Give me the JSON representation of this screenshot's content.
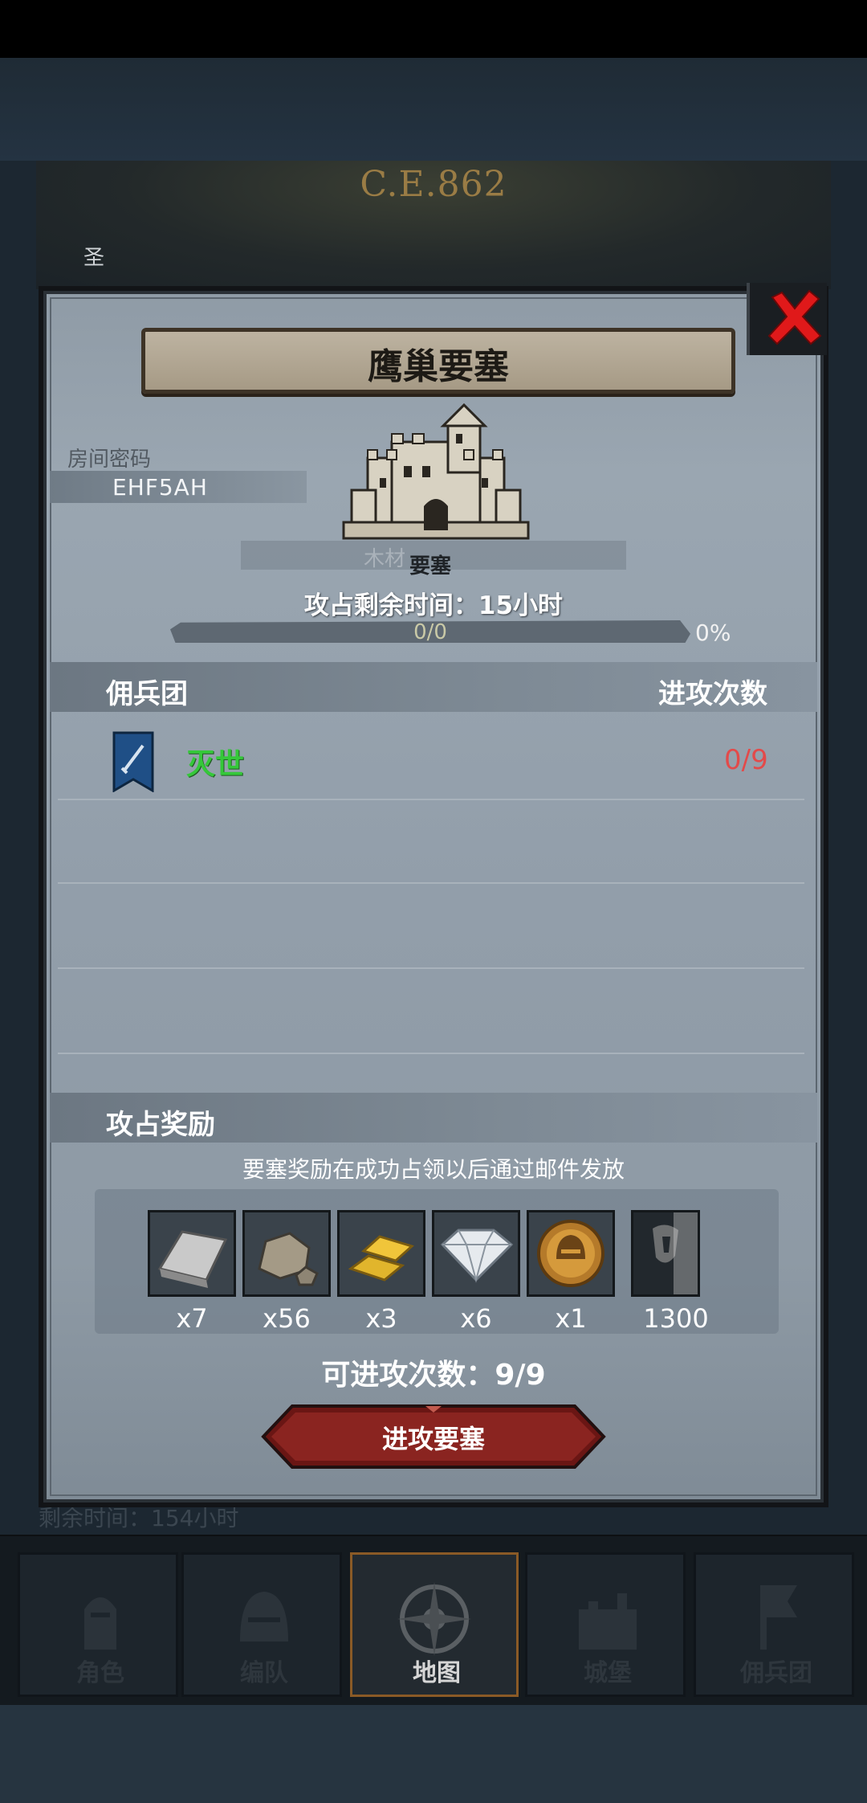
{
  "background": {
    "year": "C.E.862",
    "side_label": "圣",
    "behind_text": "剩余时间：154小时"
  },
  "modal": {
    "title": "鹰巢要塞",
    "room_code_label": "房间密码",
    "room_code": "EHF5AH",
    "type_label_ghost": "木材",
    "type_label": "要塞",
    "remaining_time": "攻占剩余时间：15小时",
    "progress_text": "0/0",
    "progress_value": 0,
    "progress_percent": "0%",
    "list_header": {
      "left": "佣兵团",
      "right": "进攻次数"
    },
    "rows": [
      {
        "name": "灭世",
        "count": "0/9"
      }
    ],
    "reward_title": "攻占奖励",
    "reward_note": "要塞奖励在成功占领以后通过邮件发放",
    "rewards": [
      {
        "icon": "iron-ingot-icon",
        "qty": "x7"
      },
      {
        "icon": "stone-icon",
        "qty": "x56"
      },
      {
        "icon": "gold-bars-icon",
        "qty": "x3"
      },
      {
        "icon": "diamond-icon",
        "qty": "x6"
      },
      {
        "icon": "helmet-medal-icon",
        "qty": "x1"
      },
      {
        "icon": "mercenary-banner-icon",
        "qty": "1300"
      }
    ],
    "attack_count": "可进攻次数：9/9",
    "attack_button": "进攻要塞"
  },
  "nav": {
    "tabs": [
      {
        "label": "角色",
        "icon": "knight-icon",
        "active": false
      },
      {
        "label": "编队",
        "icon": "helmet-icon",
        "active": false
      },
      {
        "label": "地图",
        "icon": "compass-icon",
        "active": true
      },
      {
        "label": "城堡",
        "icon": "castle-icon",
        "active": false
      },
      {
        "label": "佣兵团",
        "icon": "flag-icon",
        "active": false
      }
    ]
  },
  "colors": {
    "panel": "#929eaa",
    "accent_green": "#35c83a",
    "accent_red": "#e34a4a",
    "button_red": "#7a1f1c",
    "close_red": "#e0191a"
  }
}
